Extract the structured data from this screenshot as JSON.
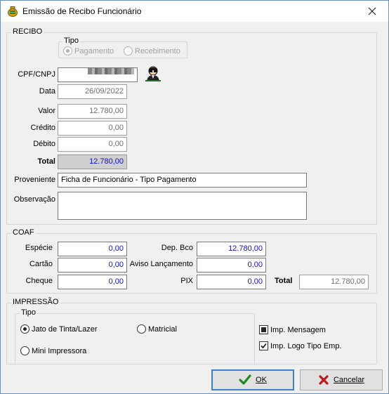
{
  "window": {
    "title": "Emissão de Recibo Funcionário",
    "close_icon": "close-icon"
  },
  "recibo": {
    "legend": "RECIBO",
    "tipo": {
      "legend": "Tipo",
      "options": [
        {
          "label": "Pagamento",
          "selected": true
        },
        {
          "label": "Recebimento",
          "selected": false
        }
      ]
    },
    "cpf_label": "CPF/CNPJ",
    "cpf_value": "",
    "data_label": "Data",
    "data_value": "26/09/2022",
    "valor_label": "Valor",
    "valor_value": "12.780,00",
    "credito_label": "Crédito",
    "credito_value": "0,00",
    "debito_label": "Débito",
    "debito_value": "0,00",
    "total_label": "Total",
    "total_value": "12.780,00",
    "proveniente_label": "Proveniente",
    "proveniente_value": "Ficha de Funcionário  - Tipo Pagamento",
    "observacao_label": "Observação",
    "observacao_value": ""
  },
  "coaf": {
    "legend": "COAF",
    "especie_label": "Espécie",
    "especie_value": "0,00",
    "cartao_label": "Cartão",
    "cartao_value": "0,00",
    "cheque_label": "Cheque",
    "cheque_value": "0,00",
    "dep_bco_label": "Dep. Bco",
    "dep_bco_value": "12.780,00",
    "aviso_label": "Aviso Lançamento",
    "aviso_value": "0,00",
    "pix_label": "PIX",
    "pix_value": "0,00",
    "total_label": "Total",
    "total_value": "12.780,00"
  },
  "impressao": {
    "legend": "IMPRESSÃO",
    "tipo_legend": "Tipo",
    "options": [
      {
        "label": "Jato de Tinta/Lazer",
        "selected": true
      },
      {
        "label": "Matricial",
        "selected": false
      },
      {
        "label": "Mini Impressora",
        "selected": false
      }
    ],
    "imp_mensagem_label": "Imp. Mensagem",
    "imp_logo_label": "Imp. Logo Tipo Emp."
  },
  "buttons": {
    "ok_label": "OK",
    "cancel_label": "Cancelar"
  },
  "colors": {
    "accent": "#3c7fd6",
    "value_blue": "#1010b0",
    "ok_green": "#1f8a1f",
    "cancel_red": "#c01818"
  }
}
